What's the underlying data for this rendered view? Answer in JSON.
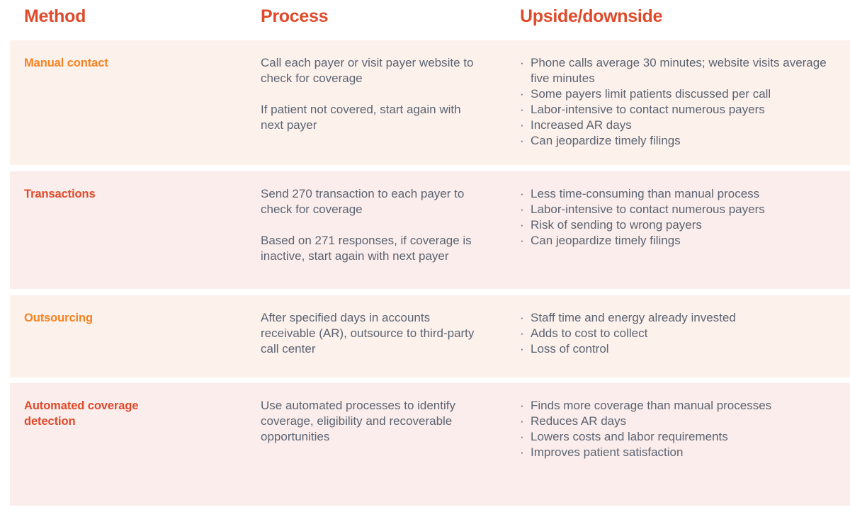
{
  "table": {
    "columns": [
      {
        "label": "Method"
      },
      {
        "label": "Process"
      },
      {
        "label": "Upside/downside"
      }
    ],
    "bullet_glyph": "·",
    "colors": {
      "header_text": "#DF4A2B",
      "method_orange": "#F58220",
      "method_red": "#DF4A2B",
      "body_text": "#5B6472",
      "row_tint_a": "#FDF1EC",
      "row_tint_b": "#FBEDEB",
      "page_background": "#FFFFFF"
    },
    "rows": [
      {
        "method": "Manual contact",
        "method_color": "orange",
        "tint": "a",
        "process": [
          "Call each payer or visit payer website to check for coverage",
          "If patient not covered, start again with next payer"
        ],
        "upside_downside": [
          "Phone calls average 30 minutes; website visits average five minutes",
          "Some payers limit patients discussed per call",
          "Labor-intensive to contact numerous payers",
          "Increased AR days",
          "Can jeopardize timely filings"
        ]
      },
      {
        "method": "Transactions",
        "method_color": "red",
        "tint": "b",
        "process": [
          "Send 270 transaction to each payer to check for coverage",
          "Based on 271 responses, if coverage is inactive, start again with next payer"
        ],
        "upside_downside": [
          "Less time-consuming than manual process",
          "Labor-intensive to contact numerous payers",
          "Risk of sending to wrong payers",
          "Can jeopardize timely filings"
        ]
      },
      {
        "method": "Outsourcing",
        "method_color": "orange",
        "tint": "a",
        "process": [
          "After specified days in accounts receivable (AR), outsource to third-party call center"
        ],
        "upside_downside": [
          "Staff time and energy already invested",
          "Adds to cost to collect",
          "Loss of control"
        ]
      },
      {
        "method": "Automated coverage detection",
        "method_color": "red",
        "tint": "b",
        "process": [
          "Use automated processes to identify coverage, eligibility and recoverable opportunities"
        ],
        "upside_downside": [
          "Finds more coverage than manual processes",
          "Reduces AR days",
          "Lowers costs and labor requirements",
          "Improves patient satisfaction"
        ]
      }
    ]
  }
}
